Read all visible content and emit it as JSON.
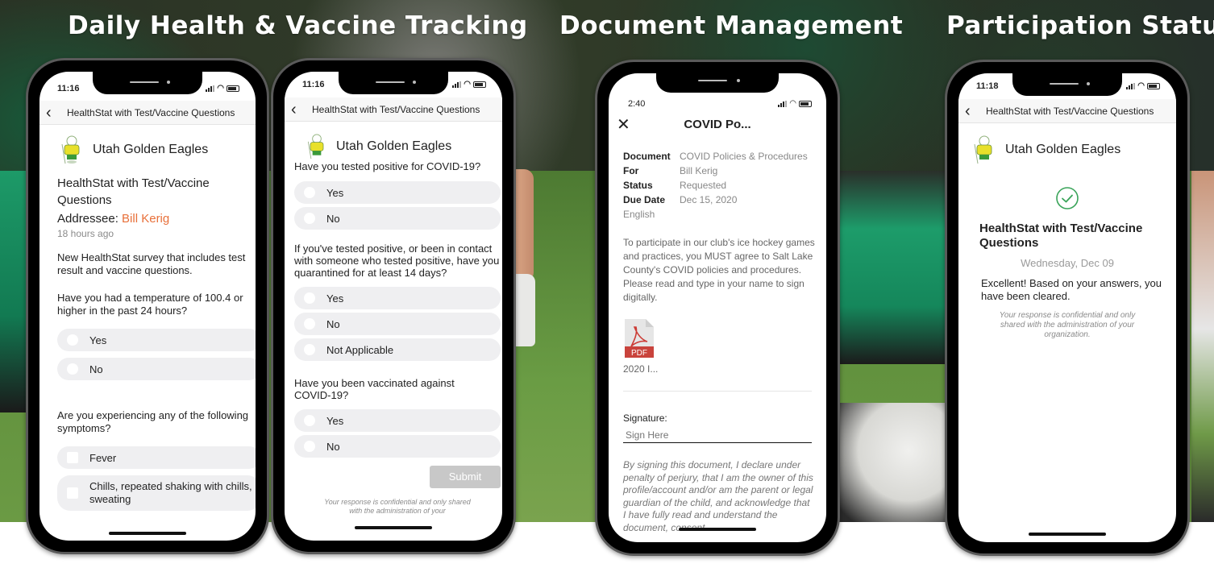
{
  "sections": {
    "health_title": "Daily Health & Vaccine Tracking",
    "document_title": "Document Management",
    "participation_title": "Participation Status"
  },
  "colors": {
    "accent_orange": "#e8703a",
    "success_green": "#3aa45a",
    "submit_disabled": "#c8c8c8"
  },
  "phone1": {
    "time": "11:16",
    "nav_title": "HealthStat with Test/Vaccine Questions",
    "back_icon": "chevron-left-icon",
    "org_name": "Utah Golden Eagles",
    "survey_title": "HealthStat with Test/Vaccine Questions",
    "addressee_label": "Addressee: ",
    "addressee_name": "Bill Kerig",
    "time_ago": "18 hours ago",
    "description": "New HealthStat survey that includes test result and vaccine questions.",
    "q1": {
      "text": "Have you had a temperature of 100.4 or higher in the past 24 hours?",
      "options": [
        "Yes",
        "No"
      ]
    },
    "q2": {
      "text": "Are you experiencing any of the following symptoms?",
      "options": [
        "Fever",
        "Chills, repeated shaking with chills, sweating"
      ]
    }
  },
  "phone2": {
    "time": "11:16",
    "nav_title": "HealthStat with Test/Vaccine Questions",
    "org_name": "Utah Golden Eagles",
    "q1": {
      "text": "Have you tested positive for COVID-19?",
      "options": [
        "Yes",
        "No"
      ]
    },
    "q2": {
      "text": "If you've tested positive, or been in contact with someone who tested positive, have you quarantined for at least 14 days?",
      "options": [
        "Yes",
        "No",
        "Not Applicable"
      ]
    },
    "q3": {
      "text": "Have you been vaccinated against COVID-19?",
      "options": [
        "Yes",
        "No"
      ]
    },
    "submit_label": "Submit",
    "footer_note": "Your response is confidential and only shared with the administration of your"
  },
  "phone3": {
    "time": "2:40",
    "title": "COVID Po...",
    "close_icon": "close-icon",
    "meta": [
      {
        "key": "Document",
        "value": "COVID Policies & Procedures"
      },
      {
        "key": "For",
        "value": "Bill Kerig"
      },
      {
        "key": "Status",
        "value": "Requested"
      },
      {
        "key": "Due Date",
        "value": "Dec 15, 2020"
      }
    ],
    "language": "English",
    "description": "To participate in our club's ice hockey games and practices, you MUST agree to Salt Lake County's COVID policies and procedures. Please read and type in your name to sign digitally.",
    "attachment": {
      "type_label": "PDF",
      "name": "2020 I..."
    },
    "signature_label": "Signature:",
    "signature_placeholder": "Sign Here",
    "legal_text": "By signing this document, I declare under penalty of perjury, that I am the owner of this profile/account and/or am the parent or legal guardian of the child, and acknowledge that I have fully read and understand the document, consent"
  },
  "phone4": {
    "time": "11:18",
    "nav_title": "HealthStat with Test/Vaccine Questions",
    "org_name": "Utah Golden Eagles",
    "result_title": "HealthStat with Test/Vaccine Questions",
    "date": "Wednesday, Dec 09",
    "message": "Excellent!  Based on your answers, you have been cleared.",
    "note": "Your response is confidential and only shared with the administration of your organization."
  }
}
